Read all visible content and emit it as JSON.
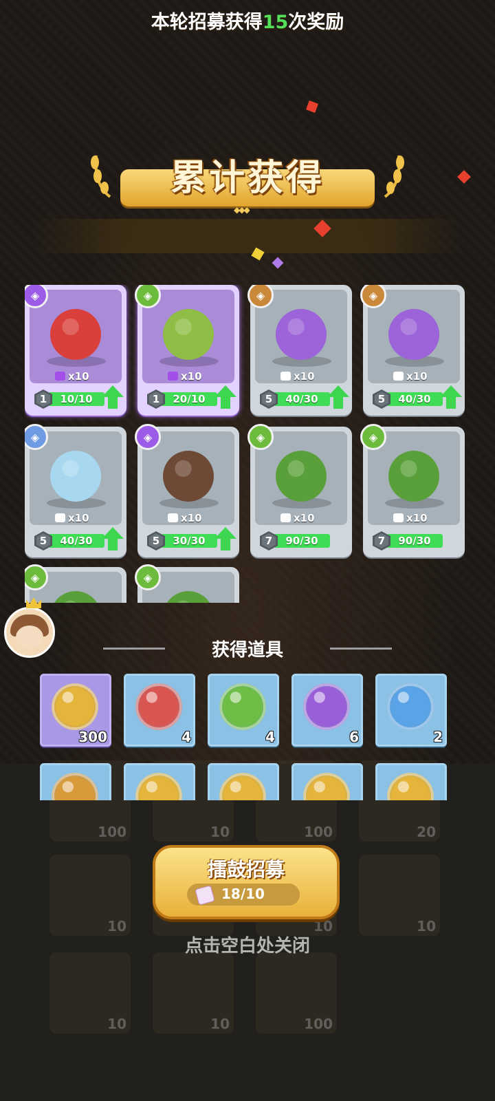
{
  "header": {
    "title": "累计获得",
    "subtitle_prefix": "本轮招募获得",
    "subtitle_count": "15",
    "subtitle_suffix": "次奖励"
  },
  "heroes": [
    {
      "badge": "purple",
      "badge_color": "#9c5ce8",
      "hero_color": "#d9403b",
      "shards": "x10",
      "level": "1",
      "progress": "10/10",
      "upgrade": true,
      "rarity": "purple"
    },
    {
      "badge": "green",
      "badge_color": "#6dbb3c",
      "hero_color": "#8fbd45",
      "shards": "x10",
      "level": "1",
      "progress": "20/10",
      "upgrade": true,
      "rarity": "purple"
    },
    {
      "badge": "orange",
      "badge_color": "#c9883a",
      "hero_color": "#9c64d8",
      "shards": "x10",
      "level": "5",
      "progress": "40/30",
      "upgrade": true,
      "rarity": "normal"
    },
    {
      "badge": "orange",
      "badge_color": "#c9883a",
      "hero_color": "#9c64d8",
      "shards": "x10",
      "level": "5",
      "progress": "40/30",
      "upgrade": true,
      "rarity": "normal"
    },
    {
      "badge": "blue",
      "badge_color": "#6f9be4",
      "hero_color": "#a8d8f0",
      "shards": "x10",
      "level": "5",
      "progress": "40/30",
      "upgrade": true,
      "rarity": "normal"
    },
    {
      "badge": "purple",
      "badge_color": "#9c5ce8",
      "hero_color": "#6e4a36",
      "shards": "x10",
      "level": "5",
      "progress": "30/30",
      "upgrade": true,
      "rarity": "normal"
    },
    {
      "badge": "green",
      "badge_color": "#6dbb3c",
      "hero_color": "#5aa03a",
      "shards": "x10",
      "level": "7",
      "progress": "90/30",
      "upgrade": false,
      "rarity": "normal"
    },
    {
      "badge": "green",
      "badge_color": "#6dbb3c",
      "hero_color": "#5aa03a",
      "shards": "x10",
      "level": "7",
      "progress": "90/30",
      "upgrade": false,
      "rarity": "normal"
    },
    {
      "badge": "green",
      "badge_color": "#6dbb3c",
      "hero_color": "#5aa03a",
      "shards": "",
      "level": "",
      "progress": "",
      "upgrade": false,
      "rarity": "normal"
    },
    {
      "badge": "green",
      "badge_color": "#6dbb3c",
      "hero_color": "#5aa03a",
      "shards": "",
      "level": "",
      "progress": "",
      "upgrade": false,
      "rarity": "normal"
    }
  ],
  "items_section": {
    "title": "获得道具",
    "items": [
      {
        "icon": "gold-coin-icon",
        "color": "#e5b43a",
        "count": "300",
        "style": "pur"
      },
      {
        "icon": "sword-orb-icon",
        "color": "#d9554f",
        "count": "4",
        "style": "blue"
      },
      {
        "icon": "bow-orb-icon",
        "color": "#6fbd45",
        "count": "4",
        "style": "blue"
      },
      {
        "icon": "staff-orb-icon",
        "color": "#9a5ed8",
        "count": "6",
        "style": "blue"
      },
      {
        "icon": "spiral-orb-icon",
        "color": "#5aa3e6",
        "count": "2",
        "style": "blue"
      },
      {
        "icon": "wing-coin-icon",
        "color": "#d99a3a",
        "count": "",
        "style": "blue"
      },
      {
        "icon": "gold-coin-icon",
        "color": "#e5b43a",
        "count": "",
        "style": "blue"
      },
      {
        "icon": "gold-coin-icon",
        "color": "#e5b43a",
        "count": "",
        "style": "blue"
      },
      {
        "icon": "gold-coin-icon",
        "color": "#e5b43a",
        "count": "",
        "style": "blue"
      },
      {
        "icon": "gold-coin-icon",
        "color": "#e5b43a",
        "count": "",
        "style": "blue"
      }
    ]
  },
  "background_rewards": {
    "row1": [
      "100",
      "10",
      "100",
      "20"
    ],
    "row2": [
      "10",
      "",
      "10",
      "10"
    ],
    "row3": [
      "10",
      "10",
      "100"
    ]
  },
  "recruit_button": {
    "label": "擂鼓招募",
    "cost": "18/10"
  },
  "close_hint": "点击空白处关闭"
}
